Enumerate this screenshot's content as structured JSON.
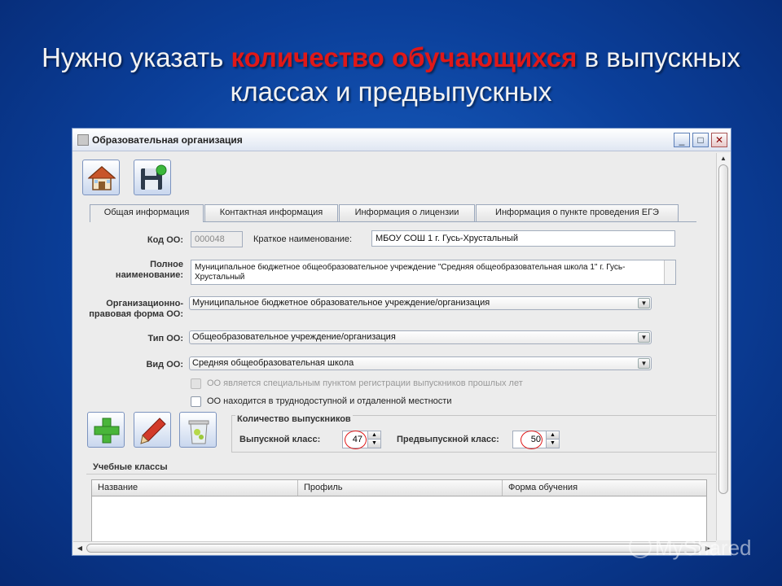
{
  "slide": {
    "title_part1": "Нужно указать ",
    "title_highlight": "количество обучающихся",
    "title_part2": " в выпускных классах и предвыпускных"
  },
  "window": {
    "title": "Образовательная организация",
    "controls": [
      "minimize",
      "maximize",
      "close"
    ]
  },
  "toolbar": {
    "home_icon": "home-icon",
    "save_icon": "save-icon"
  },
  "tabs": [
    {
      "label": "Общая информация",
      "active": true
    },
    {
      "label": "Контактная информация",
      "active": false
    },
    {
      "label": "Информация о лицензии",
      "active": false
    },
    {
      "label": "Информация о пункте проведения ЕГЭ",
      "active": false
    }
  ],
  "form": {
    "code_label": "Код ОО:",
    "code_value": "000048",
    "short_name_label": "Краткое наименование:",
    "short_name_value": "МБОУ СОШ 1 г. Гусь-Хрустальный",
    "full_name_label_1": "Полное",
    "full_name_label_2": "наименование:",
    "full_name_value": "Муниципальное бюджетное общеобразовательное учреждение \"Средняя общеобразовательная школа 1\" г. Гусь-Хрустальный",
    "legal_form_label_1": "Организационно-",
    "legal_form_label_2": "правовая форма ОО:",
    "legal_form_value": "Муниципальное бюджетное образовательное учреждение/организация",
    "type_label": "Тип ОО:",
    "type_value": "Общеобразовательное учреждение/организация",
    "kind_label": "Вид ОО:",
    "kind_value": "Средняя общеобразовательная школа",
    "checkbox_special_label": "ОО является специальным пунктом регистрации выпускников прошлых лет",
    "checkbox_remote_label": "ОО находится в труднодоступной и отдаленной местности"
  },
  "actions": {
    "add_icon": "plus-icon",
    "edit_icon": "pencil-icon",
    "delete_icon": "trash-icon"
  },
  "graduates": {
    "group_title": "Количество выпускников",
    "graduate_class_label": "Выпускной класс:",
    "graduate_class_value": "47",
    "pre_graduate_class_label": "Предвыпускной класс:",
    "pre_graduate_class_value": "50"
  },
  "classes": {
    "section_title": "Учебные классы",
    "columns": [
      "Название",
      "Профиль",
      "Форма обучения"
    ]
  },
  "watermark": "MyShared",
  "colors": {
    "highlight": "#e01818",
    "background": "#0b3f9a"
  }
}
